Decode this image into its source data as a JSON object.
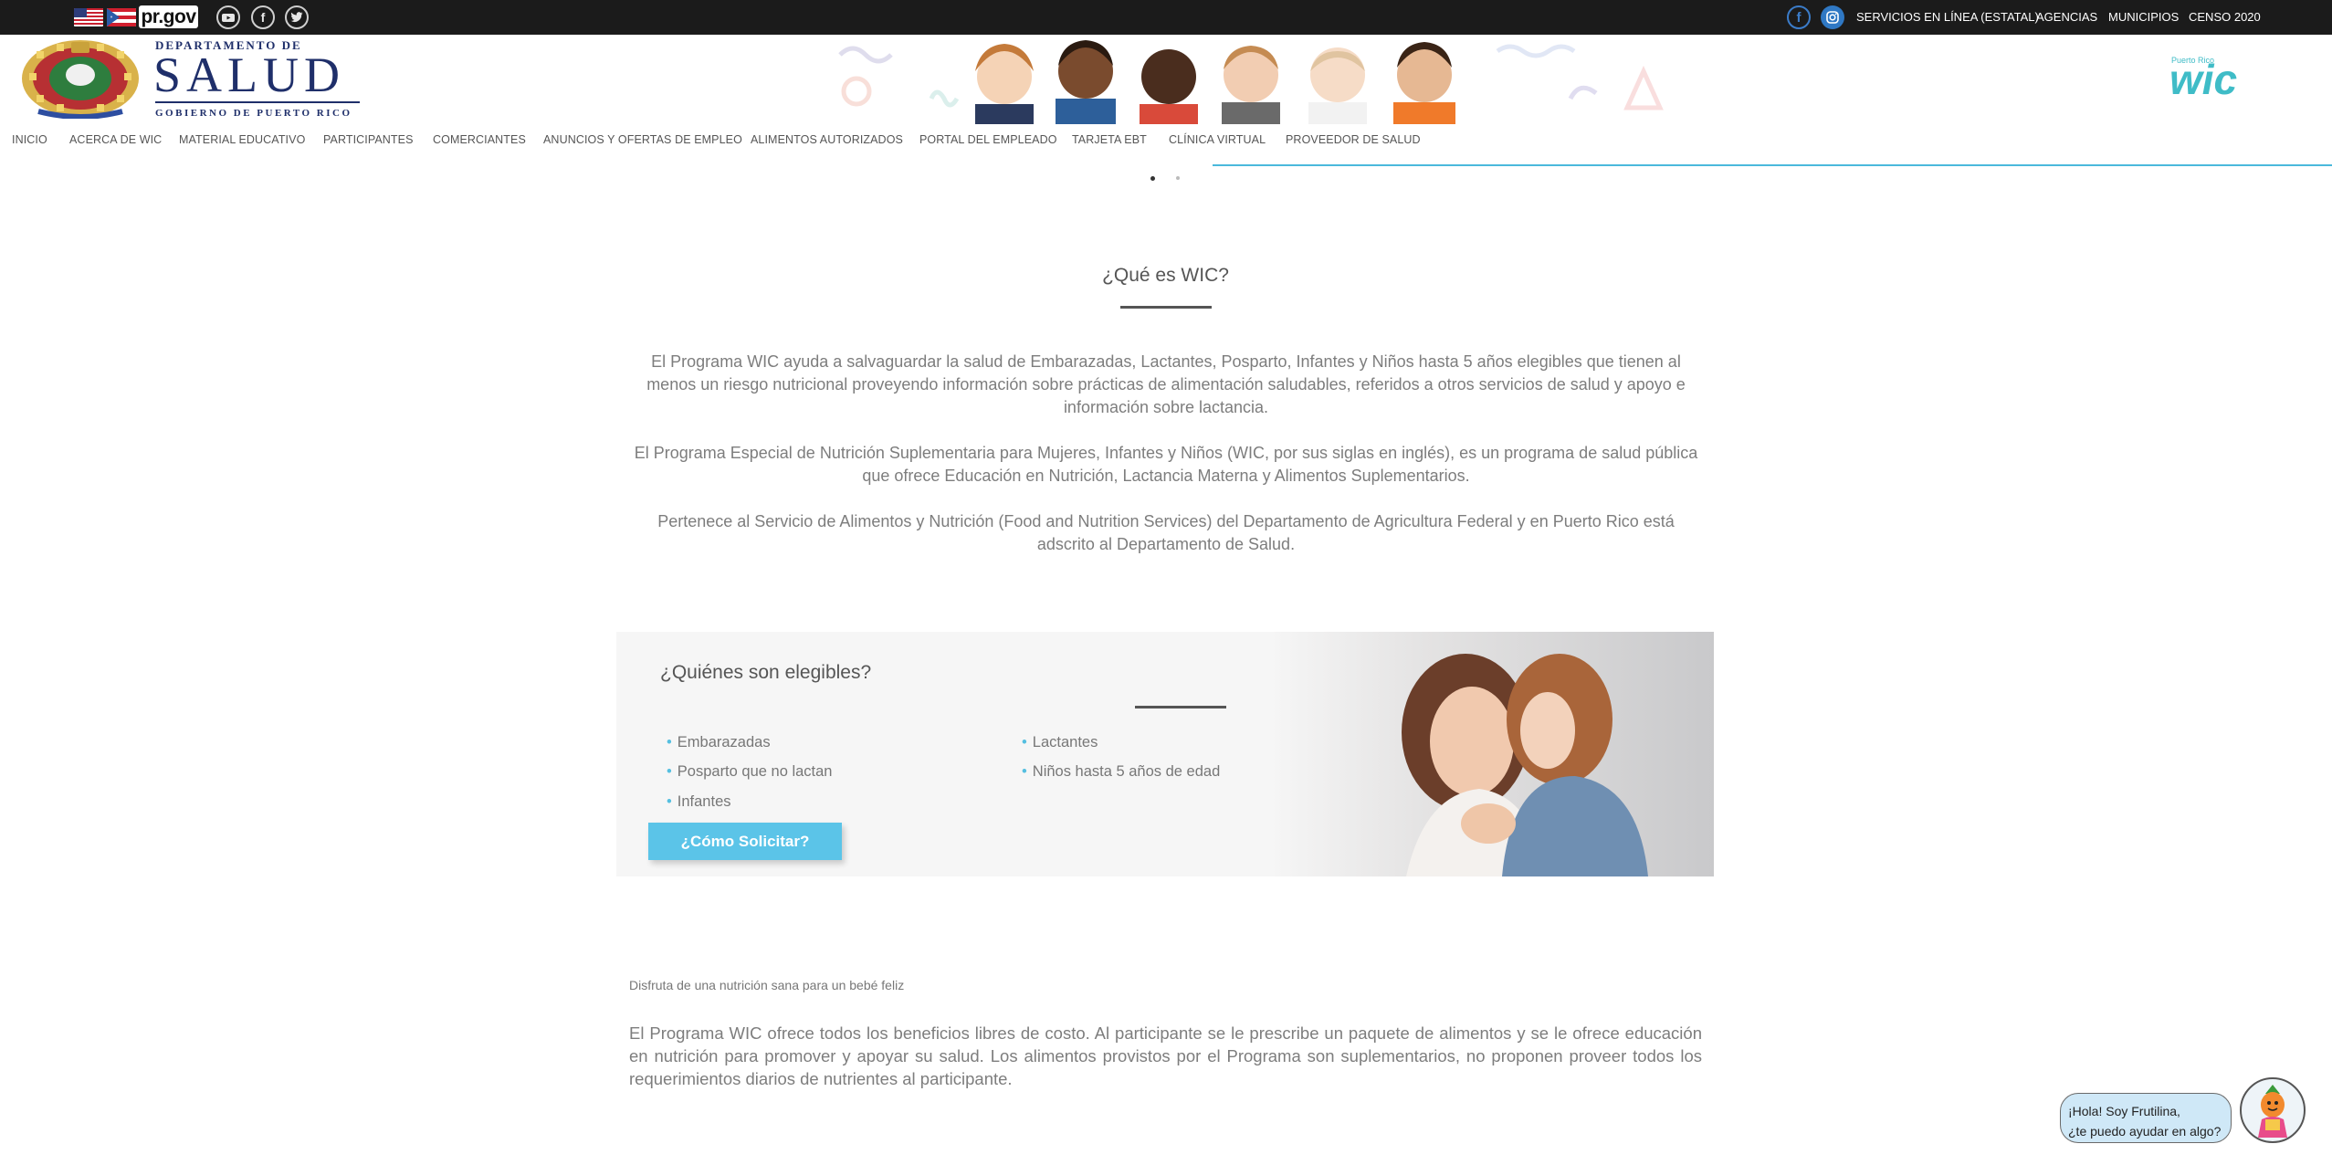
{
  "topbar": {
    "prgov": "pr.gov",
    "links": [
      "SERVICIOS EN LÍNEA (ESTATAL)",
      "AGENCIAS",
      "MUNICIPIOS",
      "CENSO 2020"
    ]
  },
  "header": {
    "dept_line": "DEPARTAMENTO DE",
    "brand": "SALUD",
    "gov_line": "GOBIERNO DE PUERTO RICO",
    "wic_small": "Puerto Rico",
    "wic_logo": "wic"
  },
  "nav": {
    "items": [
      "INICIO",
      "ACERCA DE WIC",
      "MATERIAL EDUCATIVO",
      "PARTICIPANTES",
      "COMERCIANTES",
      "ANUNCIOS Y OFERTAS DE EMPLEO",
      "ALIMENTOS AUTORIZADOS",
      "PORTAL DEL EMPLEADO",
      "TARJETA EBT",
      "CLÍNICA VIRTUAL",
      "PROVEEDOR DE SALUD"
    ]
  },
  "carousel": {
    "active_index": 0,
    "count": 2
  },
  "about": {
    "title": "¿Qué es WIC?",
    "p1": "El Programa WIC ayuda a salvaguardar la salud de Embarazadas, Lactantes, Posparto, Infantes y Niños hasta 5 años elegibles que tienen al menos un riesgo nutricional proveyendo información sobre prácticas de alimentación saludables, referidos a otros servicios de salud y apoyo e información sobre lactancia.",
    "p2": "El Programa Especial de Nutrición Suplementaria para Mujeres, Infantes y Niños (WIC, por sus siglas en inglés), es un programa de salud pública que ofrece Educación en Nutrición, Lactancia Materna y Alimentos Suplementarios.",
    "p3": "Pertenece al Servicio de Alimentos y Nutrición (Food and Nutrition Services) del Departamento de Agricultura Federal y en Puerto Rico está adscrito al Departamento de Salud."
  },
  "eligibility": {
    "title": "¿Quiénes son elegibles?",
    "col1": [
      "Embarazadas",
      "Posparto que no lactan",
      "Infantes"
    ],
    "col2": [
      "Lactantes",
      "Niños hasta 5 años de edad"
    ],
    "button": "¿Cómo Solicitar?"
  },
  "benefits": {
    "subtitle": "Disfruta de una nutrición sana para un bebé feliz",
    "text": "El Programa WIC ofrece todos los beneficios libres de costo. Al participante se le prescribe un paquete de alimentos y se le ofrece educación en nutrición para promover y apoyar su salud. Los alimentos provistos por el Programa son suplementarios, no proponen proveer todos los requerimientos diarios de nutrientes al participante."
  },
  "chat": {
    "line1": "¡Hola! Soy Frutilina,",
    "line2": "¿te puedo ayudar en algo?"
  },
  "colors": {
    "accent": "#4ab9dc",
    "button": "#5bc4e8",
    "topbar": "#1b1b1b",
    "brand": "#1f2f6a"
  }
}
